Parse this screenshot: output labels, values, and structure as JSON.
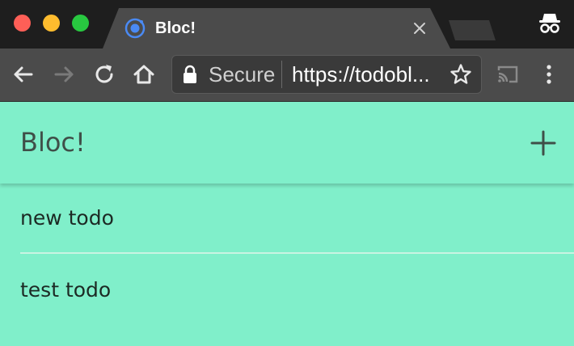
{
  "browser": {
    "tab": {
      "title": "Bloc!"
    },
    "omnibox": {
      "security_label": "Secure",
      "url": "https://todobl..."
    }
  },
  "icons": {
    "favicon": "ionic-favicon",
    "tab_close": "close-icon",
    "incognito": "incognito-icon",
    "back": "arrow-left-icon",
    "forward": "arrow-right-icon",
    "reload": "reload-icon",
    "home": "home-icon",
    "lock": "lock-icon",
    "bookmark": "star-icon",
    "cast": "cast-icon",
    "menu": "kebab-menu-icon",
    "add": "plus-icon"
  },
  "app": {
    "title": "Bloc!",
    "todos": [
      {
        "label": "new todo"
      },
      {
        "label": "test todo"
      }
    ]
  },
  "colors": {
    "page_background": "#80efca",
    "header_text": "#3f4f48",
    "chrome_dark": "#1e1e1e",
    "chrome_toolbar": "#4b4b4b"
  }
}
